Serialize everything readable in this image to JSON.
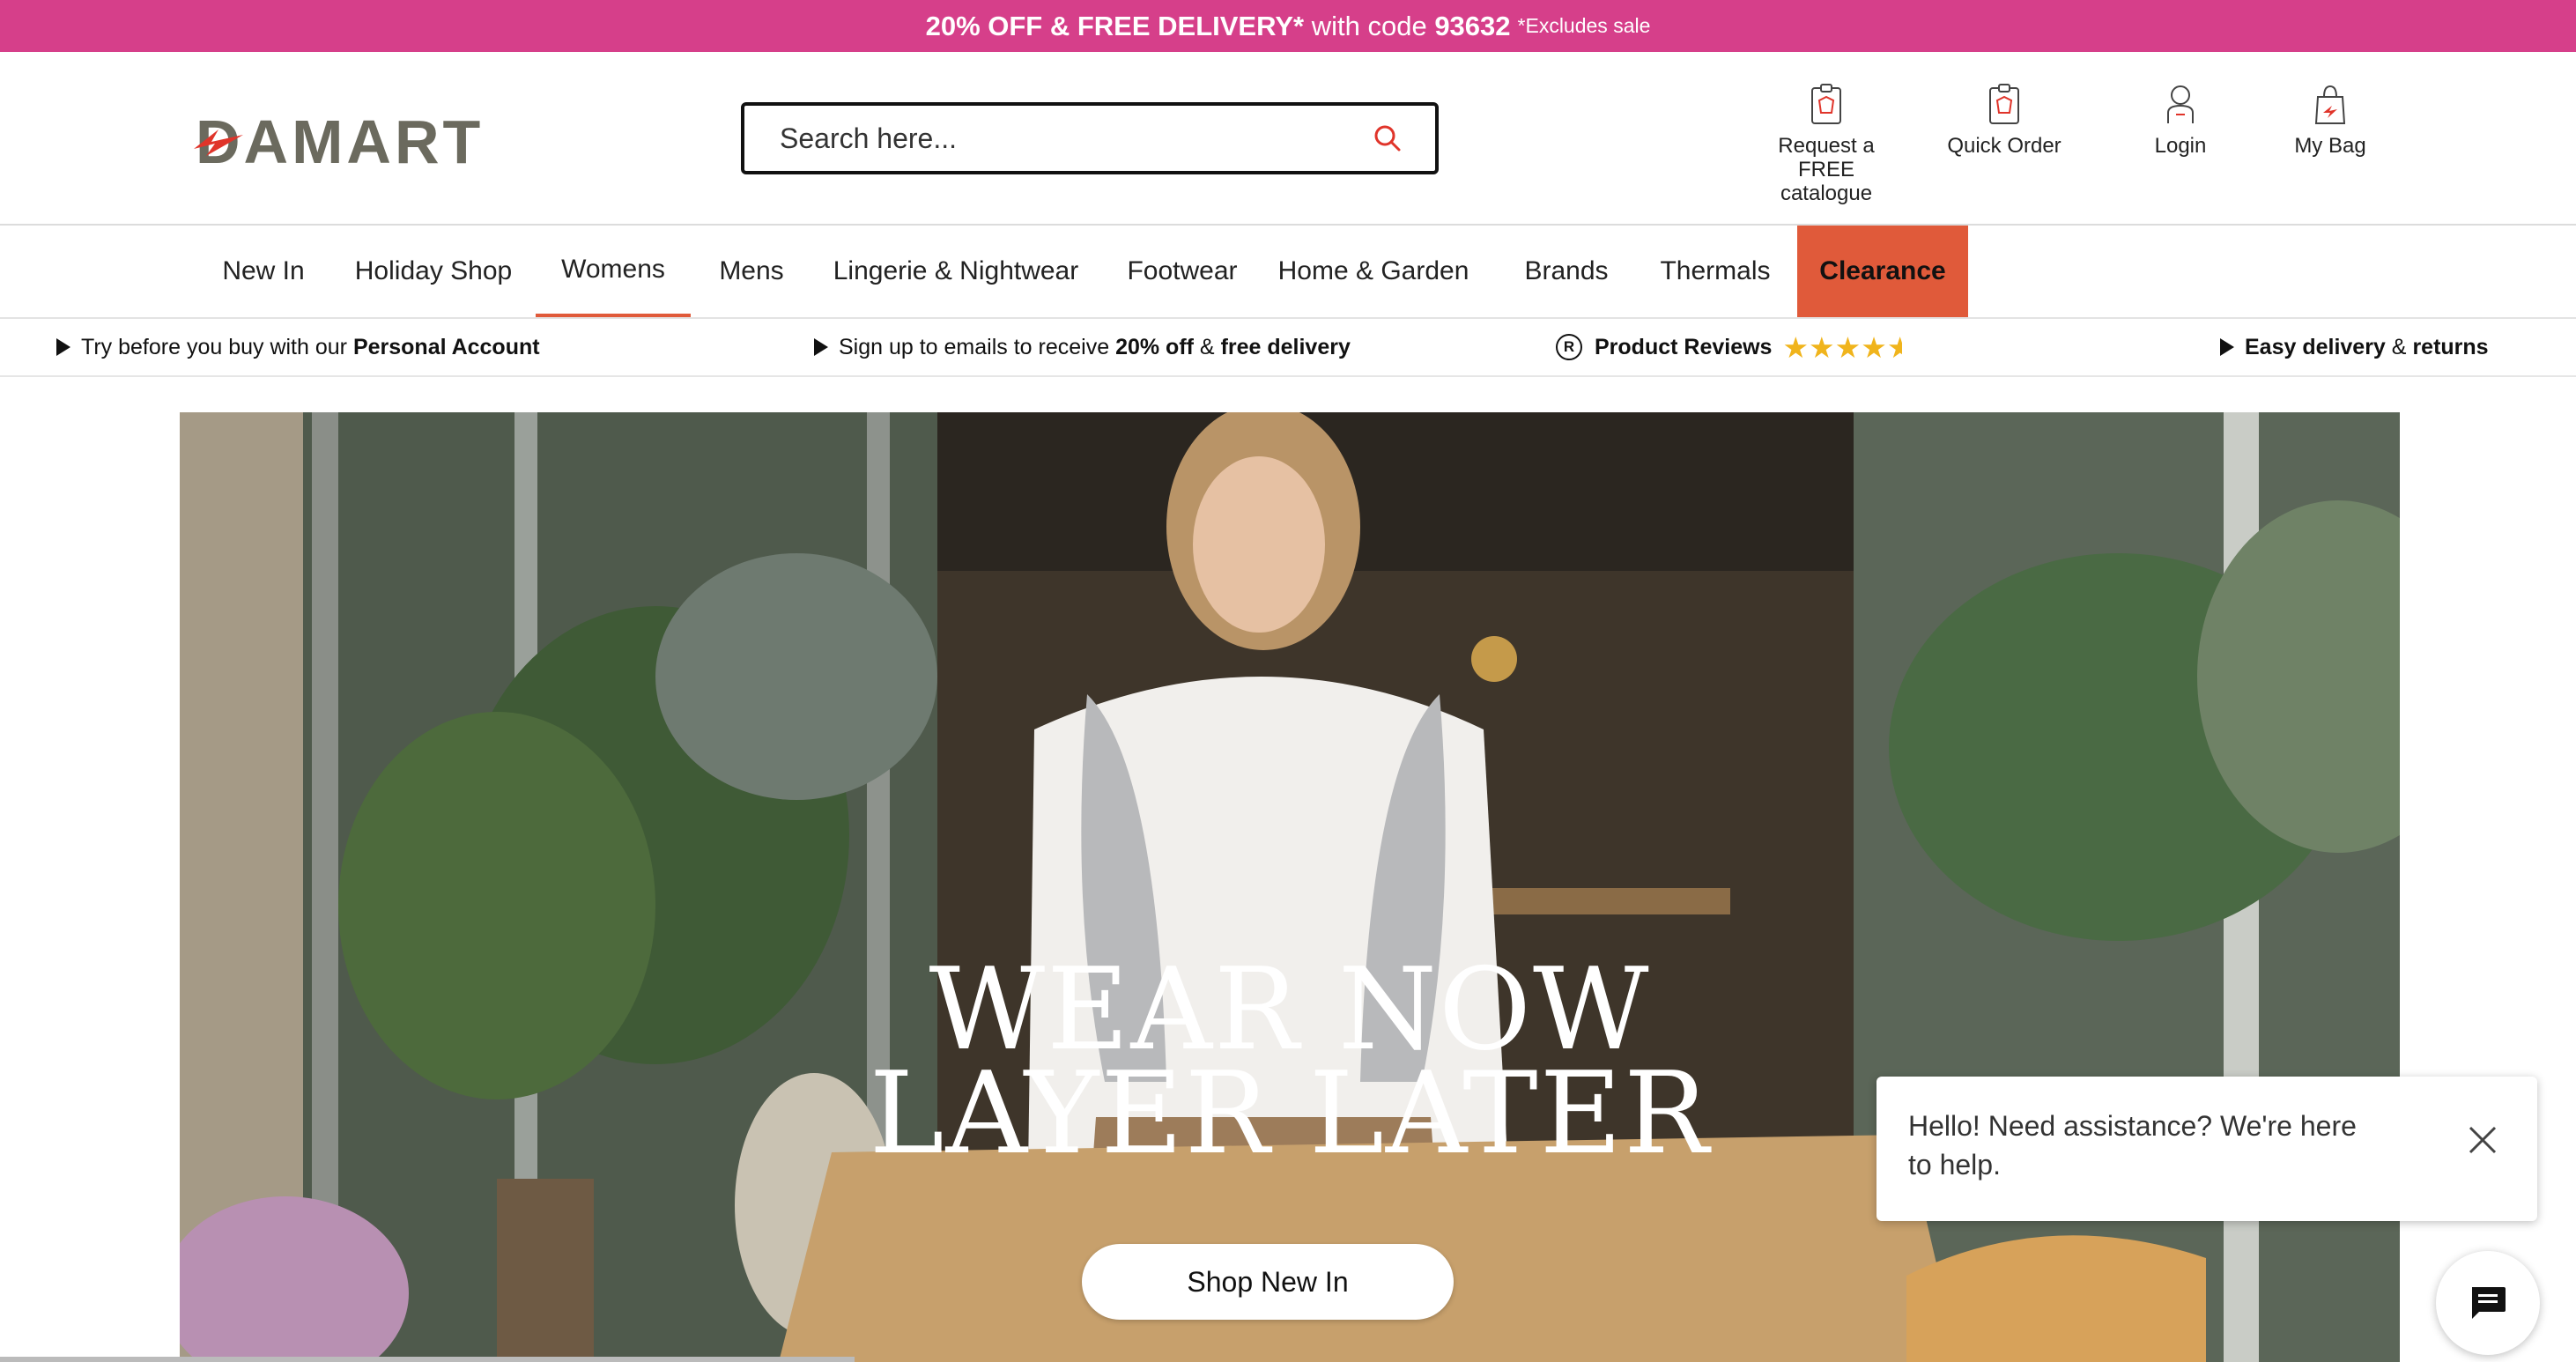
{
  "promo": {
    "bold_text": "20% OFF & FREE DELIVERY*",
    "middle_text": "with code",
    "code": "93632",
    "small_text": "*Excludes sale",
    "bg_color": "#d63f8a"
  },
  "header": {
    "logo_text": "DAMART",
    "search_placeholder": "Search here...",
    "items": [
      {
        "label": "Request a FREE catalogue",
        "icon": "catalogue-icon"
      },
      {
        "label": "Quick Order",
        "icon": "quick-order-icon"
      },
      {
        "label": "Login",
        "icon": "user-icon"
      },
      {
        "label": "My Bag",
        "icon": "bag-icon"
      }
    ],
    "catalogue_lines": [
      "Request a",
      "FREE",
      "catalogue"
    ]
  },
  "nav": {
    "items": [
      "New In",
      "Holiday Shop",
      "Womens",
      "Mens",
      "Lingerie & Nightwear",
      "Footwear",
      "Home & Garden",
      "Brands",
      "Thermals",
      "Clearance"
    ],
    "active": "Womens",
    "accent_color": "#e05a3a"
  },
  "usp": {
    "personal_prefix": "Try before you buy with our",
    "personal_bold": "Personal Account",
    "email_prefix": "Sign up to emails to receive",
    "email_bold1": "20% off",
    "email_mid": "&",
    "email_bold2": "free delivery",
    "reviews_label": "Product Reviews",
    "reviews_rating": 4.5,
    "reviews_badge": "R",
    "delivery_bold1": "Easy delivery",
    "delivery_mid": "&",
    "delivery_bold2": "returns"
  },
  "hero": {
    "headline_line1": "WEAR NOW",
    "headline_line2": "LAYER LATER",
    "cta_label": "Shop New In"
  },
  "chat": {
    "message": "Hello! Need assistance? We're here to help.",
    "close_icon": "close-icon",
    "launcher_icon": "chat-bubble-icon"
  }
}
